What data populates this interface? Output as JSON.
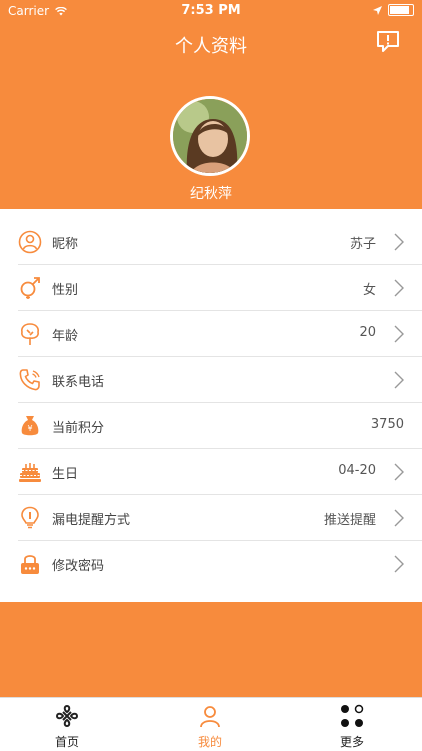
{
  "status_bar": {
    "carrier": "Carrier",
    "time": "7:53 PM"
  },
  "header": {
    "title": "个人资料",
    "username": "纪秋萍"
  },
  "profile_rows": [
    {
      "label": "昵称",
      "value": "苏子",
      "icon": "person-circle-icon",
      "chevron": true
    },
    {
      "label": "性别",
      "value": "女",
      "icon": "gender-icon",
      "chevron": true
    },
    {
      "label": "年龄",
      "value": "20",
      "icon": "tree-icon",
      "chevron": true
    },
    {
      "label": "联系电话",
      "value": "",
      "icon": "phone-icon",
      "chevron": true
    },
    {
      "label": "当前积分",
      "value": "3750",
      "icon": "money-bag-icon",
      "chevron": false
    },
    {
      "label": "生日",
      "value": "04-20",
      "icon": "cake-icon",
      "chevron": true
    },
    {
      "label": "漏电提醒方式",
      "value": "推送提醒",
      "icon": "bulb-icon",
      "chevron": true
    },
    {
      "label": "修改密码",
      "value": "",
      "icon": "lock-icon",
      "chevron": true
    }
  ],
  "tabs": [
    {
      "label": "首页",
      "icon": "unicom-logo-icon"
    },
    {
      "label": "我的",
      "icon": "user-icon"
    },
    {
      "label": "更多",
      "icon": "dots-icon"
    }
  ],
  "colors": {
    "accent": "#f78b3d",
    "tab_active": "#f78b3d"
  }
}
